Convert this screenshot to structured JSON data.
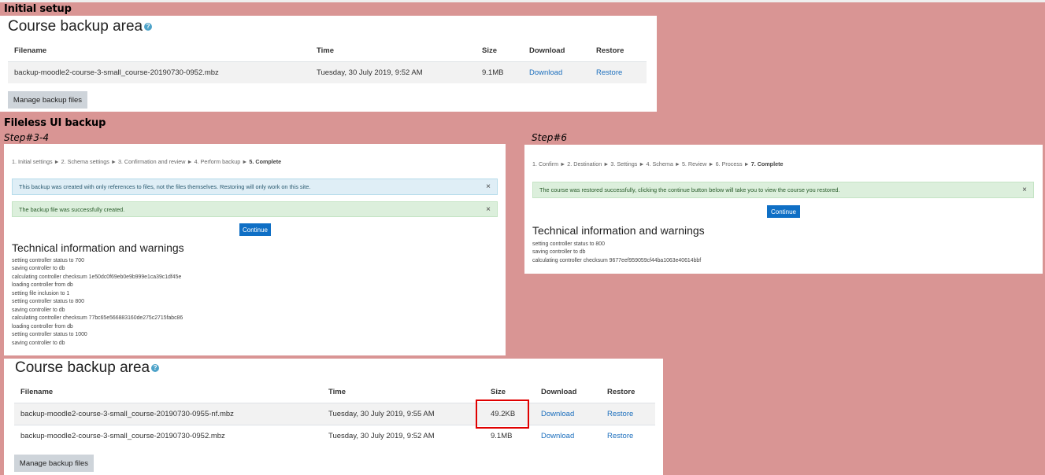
{
  "sections": {
    "initial_setup": "Initial setup",
    "fileless": "Fileless UI backup",
    "step34": "Step#3-4",
    "step6": "Step#6"
  },
  "backup_area": {
    "title": "Course backup area",
    "help_icon": "help-icon",
    "columns": [
      "Filename",
      "Time",
      "Size",
      "Download",
      "Restore"
    ],
    "manage_button": "Manage backup files"
  },
  "initial_table": {
    "rows": [
      {
        "filename": "backup-moodle2-course-3-small_course-20190730-0952.mbz",
        "time": "Tuesday, 30 July 2019, 9:52 AM",
        "size": "9.1MB",
        "download": "Download",
        "restore": "Restore"
      }
    ]
  },
  "final_table": {
    "rows": [
      {
        "filename": "backup-moodle2-course-3-small_course-20190730-0955-nf.mbz",
        "time": "Tuesday, 30 July 2019, 9:55 AM",
        "size": "49.2KB",
        "download": "Download",
        "restore": "Restore"
      },
      {
        "filename": "backup-moodle2-course-3-small_course-20190730-0952.mbz",
        "time": "Tuesday, 30 July 2019, 9:52 AM",
        "size": "9.1MB",
        "download": "Download",
        "restore": "Restore"
      }
    ]
  },
  "backup_step": {
    "breadcrumb": [
      "1. Initial settings",
      "2. Schema settings",
      "3. Confirmation and review",
      "4. Perform backup"
    ],
    "breadcrumb_current": "5. Complete",
    "alert_info": "This backup was created with only references to files, not the files themselves. Restoring will only work on this site.",
    "alert_success": "The backup file was successfully created.",
    "continue": "Continue",
    "tech_heading": "Technical information and warnings",
    "log": [
      "setting controller status to 700",
      "saving controller to db",
      "calculating controller checksum 1e50dc0f69eb0e9b999e1ca39c1df45e",
      "loading controller from db",
      "setting file inclusion to 1",
      "setting controller status to 800",
      "saving controller to db",
      "calculating controller checksum 77bc65e566883160de275c2715fabc86",
      "loading controller from db",
      "setting controller status to 1000",
      "saving controller to db"
    ]
  },
  "restore_step": {
    "breadcrumb": [
      "1. Confirm",
      "2. Destination",
      "3. Settings",
      "4. Schema",
      "5. Review",
      "6. Process"
    ],
    "breadcrumb_current": "7. Complete",
    "alert_success": "The course was restored successfully, clicking the continue button below will take you to view the course you restored.",
    "continue": "Continue",
    "tech_heading": "Technical information and warnings",
    "log": [
      "setting controller status to 800",
      "saving controller to db",
      "calculating controller checksum 9677eef959059cf44ba1063e40614bbf"
    ]
  },
  "separator": "►",
  "close_glyph": "×"
}
